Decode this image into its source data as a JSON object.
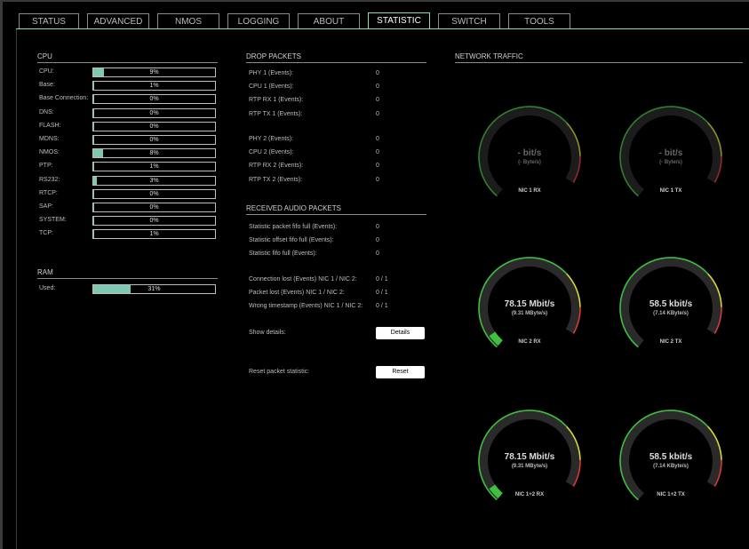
{
  "tabs": [
    "STATUS",
    "ADVANCED",
    "NMOS",
    "LOGGING",
    "ABOUT",
    "STATISTIC",
    "SWITCH",
    "TOOLS"
  ],
  "active_tab": "STATISTIC",
  "cpu": {
    "title": "CPU",
    "rows": [
      {
        "label": "CPU:",
        "value": "9%",
        "pct": 9
      },
      {
        "label": "Base:",
        "value": "1%",
        "pct": 1
      },
      {
        "label": "Base Connection:",
        "value": "0%",
        "pct": 0
      },
      {
        "label": "DNS:",
        "value": "0%",
        "pct": 0
      },
      {
        "label": "FLASH:",
        "value": "0%",
        "pct": 0
      },
      {
        "label": "MDNS:",
        "value": "0%",
        "pct": 0
      },
      {
        "label": "NMOS:",
        "value": "8%",
        "pct": 8
      },
      {
        "label": "PTP:",
        "value": "1%",
        "pct": 1
      },
      {
        "label": "RS232:",
        "value": "3%",
        "pct": 3
      },
      {
        "label": "RTCP:",
        "value": "0%",
        "pct": 0
      },
      {
        "label": "SAP:",
        "value": "0%",
        "pct": 0
      },
      {
        "label": "SYSTEM:",
        "value": "0%",
        "pct": 0
      },
      {
        "label": "TCP:",
        "value": "1%",
        "pct": 1
      }
    ]
  },
  "ram": {
    "title": "RAM",
    "rows": [
      {
        "label": "Used:",
        "value": "31%",
        "pct": 31
      }
    ]
  },
  "drop_packets": {
    "title": "DROP PACKETS",
    "group1": [
      {
        "label": "PHY 1 (Events):",
        "value": "0"
      },
      {
        "label": "CPU 1 (Events):",
        "value": "0"
      },
      {
        "label": "RTP RX 1 (Events):",
        "value": "0"
      },
      {
        "label": "RTP TX 1 (Events):",
        "value": "0"
      }
    ],
    "group2": [
      {
        "label": "PHY 2 (Events):",
        "value": "0"
      },
      {
        "label": "CPU 2 (Events):",
        "value": "0"
      },
      {
        "label": "RTP RX 2 (Events):",
        "value": "0"
      },
      {
        "label": "RTP TX 2 (Events):",
        "value": "0"
      }
    ]
  },
  "received_audio": {
    "title": "RECEIVED AUDIO PACKETS",
    "group1": [
      {
        "label": "Statistic packet fifo full (Events):",
        "value": "0"
      },
      {
        "label": "Statistic offset fifo full (Events):",
        "value": "0"
      },
      {
        "label": "Statistic fifo full (Events):",
        "value": "0"
      }
    ],
    "group2": [
      {
        "label": "Connection lost (Events) NIC 1 / NIC 2:",
        "value": "0 / 1"
      },
      {
        "label": "Packet lost (Events) NIC 1 / NIC 2:",
        "value": "0 / 1"
      },
      {
        "label": "Wrong timestamp (Events) NIC 1 / NIC 2:",
        "value": "0 / 1"
      }
    ],
    "show_details_label": "Show details:",
    "details_button": "Details",
    "reset_label": "Reset packet statistic:",
    "reset_button": "Reset"
  },
  "network_traffic": {
    "title": "NETWORK TRAFFIC",
    "gauges": [
      {
        "name": "NIC 1 RX",
        "big": "- bit/s",
        "small": "(- Byte/s)",
        "level": 0,
        "active": false
      },
      {
        "name": "NIC 1 TX",
        "big": "- bit/s",
        "small": "(- Byte/s)",
        "level": 0,
        "active": false
      },
      {
        "name": "NIC 2 RX",
        "big": "78.15 Mbit/s",
        "small": "(9.31 MByte/s)",
        "level": 0.06,
        "active": true
      },
      {
        "name": "NIC 2 TX",
        "big": "58.5 kbit/s",
        "small": "(7.14 KByte/s)",
        "level": 0,
        "active": true
      },
      {
        "name": "NIC 1+2 RX",
        "big": "78.15 Mbit/s",
        "small": "(9.31 MByte/s)",
        "level": 0.06,
        "active": true
      },
      {
        "name": "NIC 1+2 TX",
        "big": "58.5 kbit/s",
        "small": "(7.14 KByte/s)",
        "level": 0,
        "active": true
      }
    ]
  },
  "colors": {
    "accent": "#8fd9c2",
    "bar_fill": "#7fc8b3",
    "gauge_green": "#3fbf3f",
    "gauge_yellow": "#d6d63a",
    "gauge_red": "#d83a3a"
  }
}
